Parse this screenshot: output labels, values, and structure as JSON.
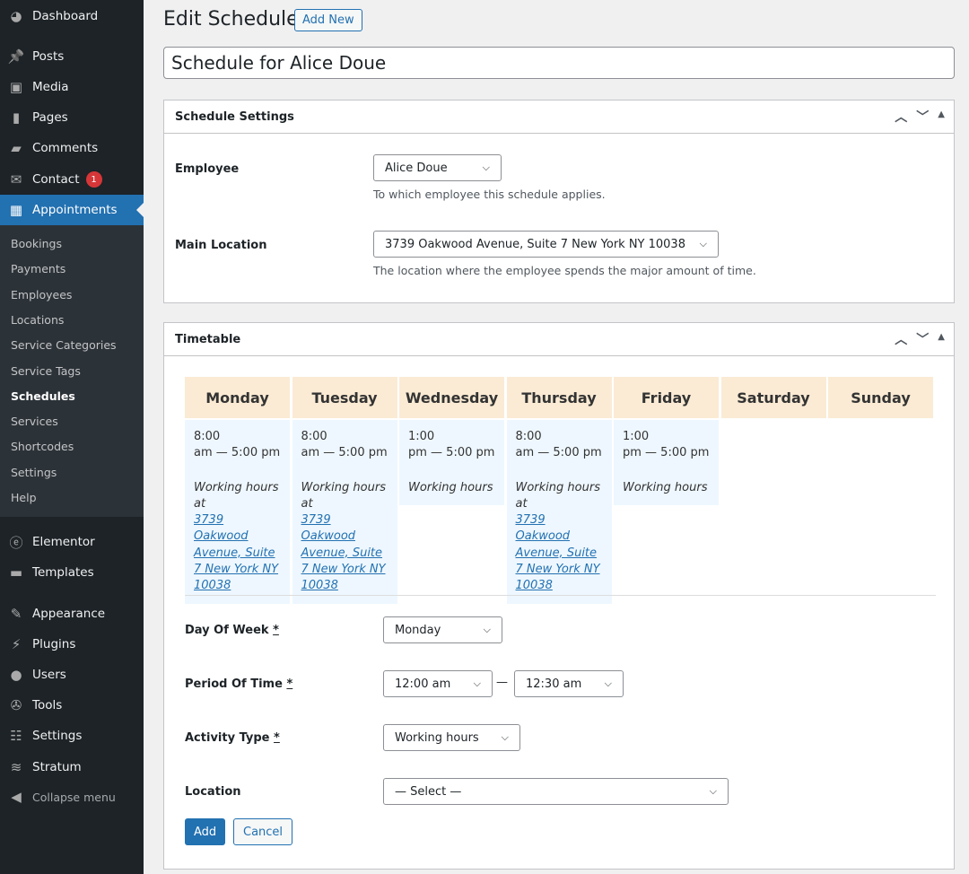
{
  "sidebar": {
    "top": [
      {
        "label": "Dashboard",
        "icon": "dashboard-icon"
      },
      {
        "label": "Posts",
        "icon": "pin-icon"
      },
      {
        "label": "Media",
        "icon": "media-icon"
      },
      {
        "label": "Pages",
        "icon": "pages-icon"
      },
      {
        "label": "Comments",
        "icon": "comment-icon"
      },
      {
        "label": "Contact",
        "icon": "mail-icon",
        "badge": "1"
      },
      {
        "label": "Appointments",
        "icon": "calendar-icon"
      }
    ],
    "sub": [
      "Bookings",
      "Payments",
      "Employees",
      "Locations",
      "Service Categories",
      "Service Tags",
      "Schedules",
      "Services",
      "Shortcodes",
      "Settings",
      "Help"
    ],
    "bottom": [
      {
        "label": "Elementor",
        "icon": "elementor-icon"
      },
      {
        "label": "Templates",
        "icon": "folder-icon"
      },
      {
        "label": "Appearance",
        "icon": "brush-icon"
      },
      {
        "label": "Plugins",
        "icon": "plugin-icon"
      },
      {
        "label": "Users",
        "icon": "user-icon"
      },
      {
        "label": "Tools",
        "icon": "wrench-icon"
      },
      {
        "label": "Settings",
        "icon": "sliders-icon"
      },
      {
        "label": "Stratum",
        "icon": "stratum-icon"
      },
      {
        "label": "Collapse menu",
        "icon": "collapse-icon"
      }
    ]
  },
  "header": {
    "title": "Edit Schedule",
    "add_new": "Add New"
  },
  "post_title": "Schedule for Alice Doue",
  "settings": {
    "title": "Schedule Settings",
    "employee_label": "Employee",
    "employee_value": "Alice Doue",
    "employee_desc": "To which employee this schedule applies.",
    "location_label": "Main Location",
    "location_value": "3739 Oakwood Avenue, Suite 7 New York NY 10038",
    "location_desc": "The location where the employee spends the major amount of time."
  },
  "timetable": {
    "title": "Timetable",
    "days": [
      "Monday",
      "Tuesday",
      "Wednesday",
      "Thursday",
      "Friday",
      "Saturday",
      "Sunday"
    ],
    "cells": [
      {
        "start": "8:00",
        "end": "am — 5:00 pm",
        "type": "Working hours",
        "at": "at",
        "location": "3739 Oakwood Avenue, Suite 7 New York NY 10038"
      },
      {
        "start": "8:00",
        "end": "am — 5:00 pm",
        "type": "Working hours",
        "at": "at",
        "location": "3739 Oakwood Avenue, Suite 7 New York NY 10038"
      },
      {
        "start": "1:00",
        "end": "pm — 5:00 pm",
        "type": "Working hours"
      },
      {
        "start": "8:00",
        "end": "am — 5:00 pm",
        "type": "Working hours",
        "at": "at",
        "location": "3739 Oakwood Avenue, Suite 7 New York NY 10038"
      },
      {
        "start": "1:00",
        "end": "pm — 5:00 pm",
        "type": "Working hours"
      }
    ],
    "form": {
      "day_label": "Day Of Week",
      "day_value": "Monday",
      "period_label": "Period Of Time",
      "period_from": "12:00 am",
      "period_sep": "—",
      "period_to": "12:30 am",
      "activity_label": "Activity Type",
      "activity_value": "Working hours",
      "location_label": "Location",
      "location_value": "— Select —",
      "required": "*",
      "add": "Add",
      "cancel": "Cancel"
    }
  }
}
